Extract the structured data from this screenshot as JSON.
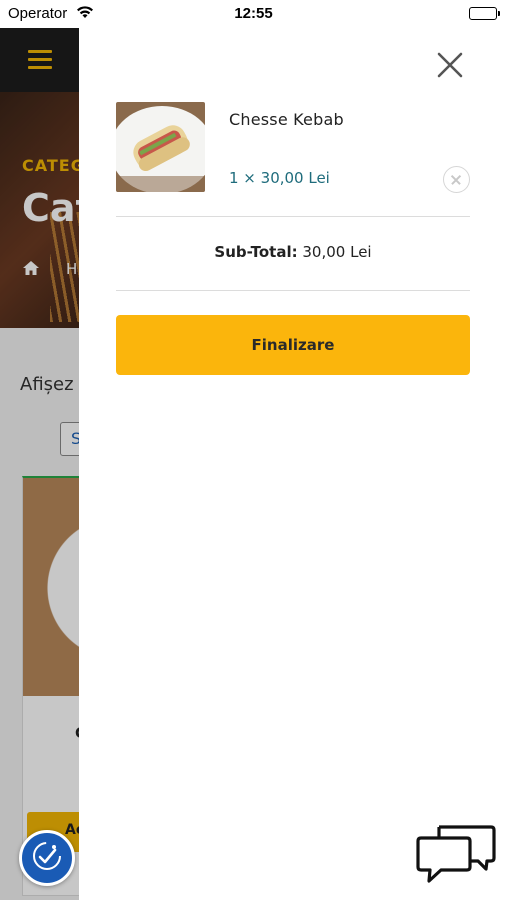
{
  "status_bar": {
    "carrier": "Operator",
    "time": "12:55"
  },
  "background_page": {
    "hero_category_label": "CATEG",
    "hero_title_partial": "Cat",
    "breadcrumb_partial": "H",
    "showing_label_partial": "Afișez",
    "sort_select_partial": "S",
    "card_title_partial": "C",
    "card_button_partial": "Ac"
  },
  "cart": {
    "items": [
      {
        "name": "Chesse Kebab",
        "quantity_price": "1 × 30,00 Lei"
      }
    ],
    "subtotal_label": "Sub-Total:",
    "subtotal_value": "30,00 Lei",
    "checkout_label": "Finalizare"
  },
  "icons": {
    "close": "close-icon",
    "remove_item": "remove-circle-icon",
    "chat": "chat-bubbles-icon",
    "accessibility": "accessibility-icon",
    "menu": "hamburger-menu-icon"
  },
  "colors": {
    "accent": "#fbb50c",
    "price_teal": "#1f6c7c",
    "nav_dark": "#1d1d1d",
    "accessibility_blue": "#1a5bb5"
  }
}
